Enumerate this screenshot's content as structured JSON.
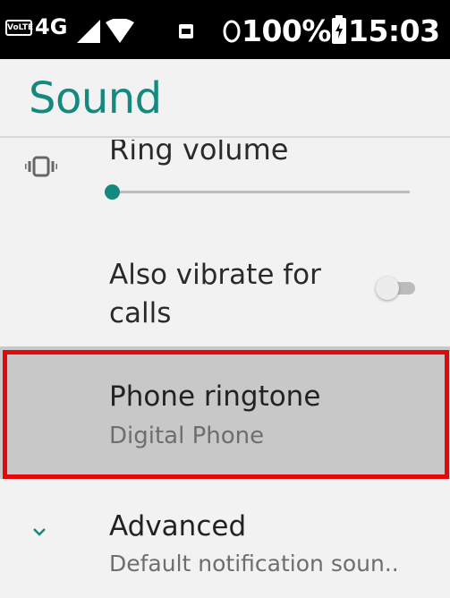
{
  "status_bar": {
    "volte": "VoLTE",
    "network": "4G",
    "battery_percent": "100%",
    "time": "15:03",
    "icons": [
      "signal-icon",
      "wifi-icon",
      "notification-icon",
      "alarm-icon",
      "battery-icon"
    ]
  },
  "header": {
    "title": "Sound"
  },
  "settings": {
    "ring_volume": {
      "label": "Ring volume",
      "level": 0.0,
      "icon": "vibrate-icon"
    },
    "also_vibrate": {
      "label": "Also vibrate for calls",
      "enabled": false
    },
    "phone_ringtone": {
      "label": "Phone ringtone",
      "value": "Digital Phone",
      "highlighted": true
    },
    "advanced": {
      "label": "Advanced",
      "summary": "Default notification soun..",
      "icon": "chevron-down-icon"
    }
  },
  "colors": {
    "accent": "#14897f",
    "highlight_border": "#e4080a",
    "selected_bg": "#c8c8c8",
    "background": "#f2f2f2"
  }
}
